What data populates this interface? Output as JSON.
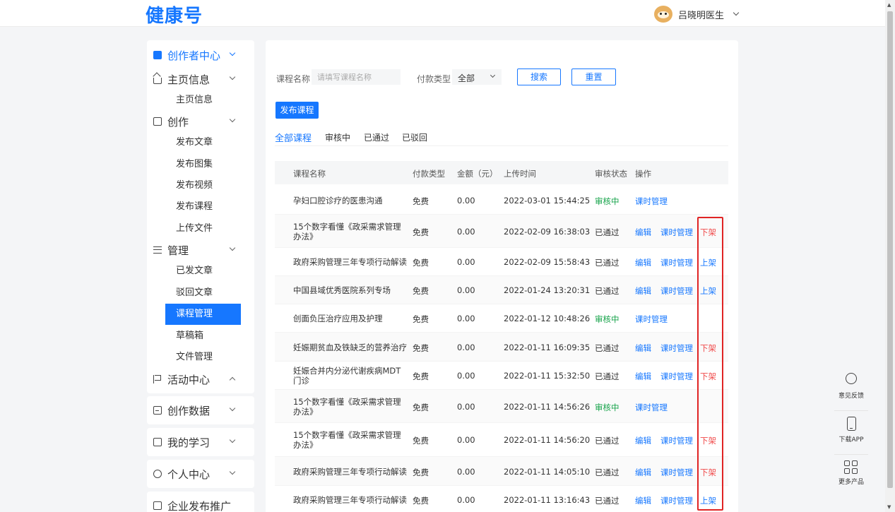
{
  "header": {
    "logo": "健康号",
    "user_name": "吕晓明医生"
  },
  "sidebar": {
    "title": "创作者中心",
    "groups": [
      {
        "label": "主页信息",
        "items": [
          "主页信息"
        ]
      },
      {
        "label": "创作",
        "items": [
          "发布文章",
          "发布图集",
          "发布视频",
          "发布课程",
          "上传文件"
        ]
      },
      {
        "label": "管理",
        "items": [
          "已发文章",
          "驳回文章",
          "课程管理",
          "草稿箱",
          "文件管理"
        ]
      },
      {
        "label": "活动中心",
        "items": []
      }
    ],
    "selected_item": "课程管理",
    "cards": [
      "创作数据",
      "我的学习",
      "个人中心",
      "企业发布推广"
    ]
  },
  "filter": {
    "course_name_label": "课程名称",
    "course_name_placeholder": "请填写课程名称",
    "payment_type_label": "付款类型",
    "payment_type_value": "全部",
    "search_label": "搜索",
    "reset_label": "重置"
  },
  "publish_label": "发布课程",
  "tabs": [
    "全部课程",
    "审核中",
    "已通过",
    "已驳回"
  ],
  "table": {
    "columns": [
      "课程名称",
      "付款类型",
      "金额（元）",
      "上传时间",
      "审核状态",
      "操作"
    ],
    "edit_label": "编辑",
    "lesson_label": "课时管理",
    "rows": [
      {
        "name": "孕妇口腔诊疗的医患沟通",
        "pay": "免费",
        "amount": "0.00",
        "time": "2022-03-01 15:44:25",
        "status": "审核中",
        "toggle": ""
      },
      {
        "name": "15个数字看懂《政采需求管理办法》",
        "pay": "免费",
        "amount": "0.00",
        "time": "2022-02-09 16:38:03",
        "status": "已通过",
        "toggle": "下架"
      },
      {
        "name": "政府采购管理三年专项行动解读",
        "pay": "免费",
        "amount": "0.00",
        "time": "2022-02-09 15:58:43",
        "status": "已通过",
        "toggle": "上架"
      },
      {
        "name": "中国县域优秀医院系列专场",
        "pay": "免费",
        "amount": "0.00",
        "time": "2022-01-24 13:20:31",
        "status": "已通过",
        "toggle": "上架"
      },
      {
        "name": "创面负压治疗应用及护理",
        "pay": "免费",
        "amount": "0.00",
        "time": "2022-01-12 10:48:26",
        "status": "审核中",
        "toggle": ""
      },
      {
        "name": "妊娠期贫血及铁缺乏的营养治疗",
        "pay": "免费",
        "amount": "0.00",
        "time": "2022-01-11 16:09:35",
        "status": "已通过",
        "toggle": "下架"
      },
      {
        "name": "妊娠合并内分泌代谢疾病MDT门诊",
        "pay": "免费",
        "amount": "0.00",
        "time": "2022-01-11 15:32:50",
        "status": "已通过",
        "toggle": "下架"
      },
      {
        "name": "15个数字看懂《政采需求管理办法》",
        "pay": "免费",
        "amount": "0.00",
        "time": "2022-01-11 14:56:26",
        "status": "审核中",
        "toggle": ""
      },
      {
        "name": "15个数字看懂《政采需求管理办法》",
        "pay": "免费",
        "amount": "0.00",
        "time": "2022-01-11 14:56:20",
        "status": "已通过",
        "toggle": "下架"
      },
      {
        "name": "政府采购管理三年专项行动解读",
        "pay": "免费",
        "amount": "0.00",
        "time": "2022-01-11 14:05:10",
        "status": "已通过",
        "toggle": "下架"
      },
      {
        "name": "政府采购管理三年专项行动解读",
        "pay": "免费",
        "amount": "0.00",
        "time": "2022-01-11 13:16:43",
        "status": "已通过",
        "toggle": "上架"
      }
    ]
  },
  "float_panel": [
    {
      "label": "意见反馈",
      "icon": "headset-icon"
    },
    {
      "label": "下载APP",
      "icon": "phone-icon"
    },
    {
      "label": "更多产品",
      "icon": "grid-icon"
    }
  ],
  "colors": {
    "primary": "#1677ff",
    "pending": "#16a34a",
    "takedown": "#f04848",
    "highlight_box": "#e02424"
  }
}
